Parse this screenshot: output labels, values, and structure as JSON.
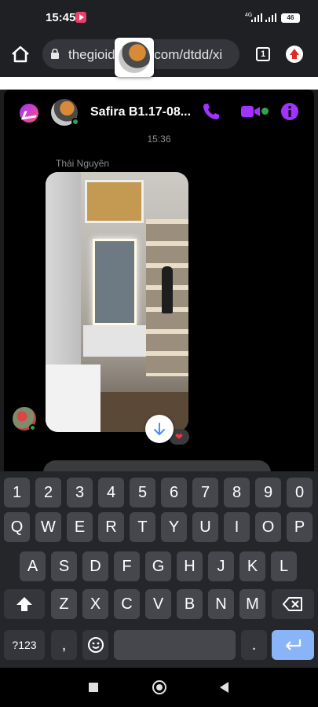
{
  "status_bar": {
    "time": "15:45",
    "network": "4G",
    "battery": "46"
  },
  "browser": {
    "url": "thegioididong.com/dtdd/xi",
    "url_visible": "thegioid",
    "url_suffix": ".com/dtdd/xi",
    "tab_count": "1"
  },
  "chat": {
    "contact_name": "Safira B1.17-08...",
    "timestamp": "15:36",
    "sender_name": "Thái Nguyên",
    "reaction": "❤"
  },
  "colors": {
    "accent": "#a033ff",
    "online": "#31a24c",
    "enter_key": "#8ab4f8"
  },
  "keyboard": {
    "row1": [
      "1",
      "2",
      "3",
      "4",
      "5",
      "6",
      "7",
      "8",
      "9",
      "0"
    ],
    "row2": [
      "Q",
      "W",
      "E",
      "R",
      "T",
      "Y",
      "U",
      "I",
      "O",
      "P"
    ],
    "row3": [
      "A",
      "S",
      "D",
      "F",
      "G",
      "H",
      "J",
      "K",
      "L"
    ],
    "row4": [
      "Z",
      "X",
      "C",
      "V",
      "B",
      "N",
      "M"
    ],
    "symbols_label": "?123",
    "comma": ",",
    "period": "."
  }
}
